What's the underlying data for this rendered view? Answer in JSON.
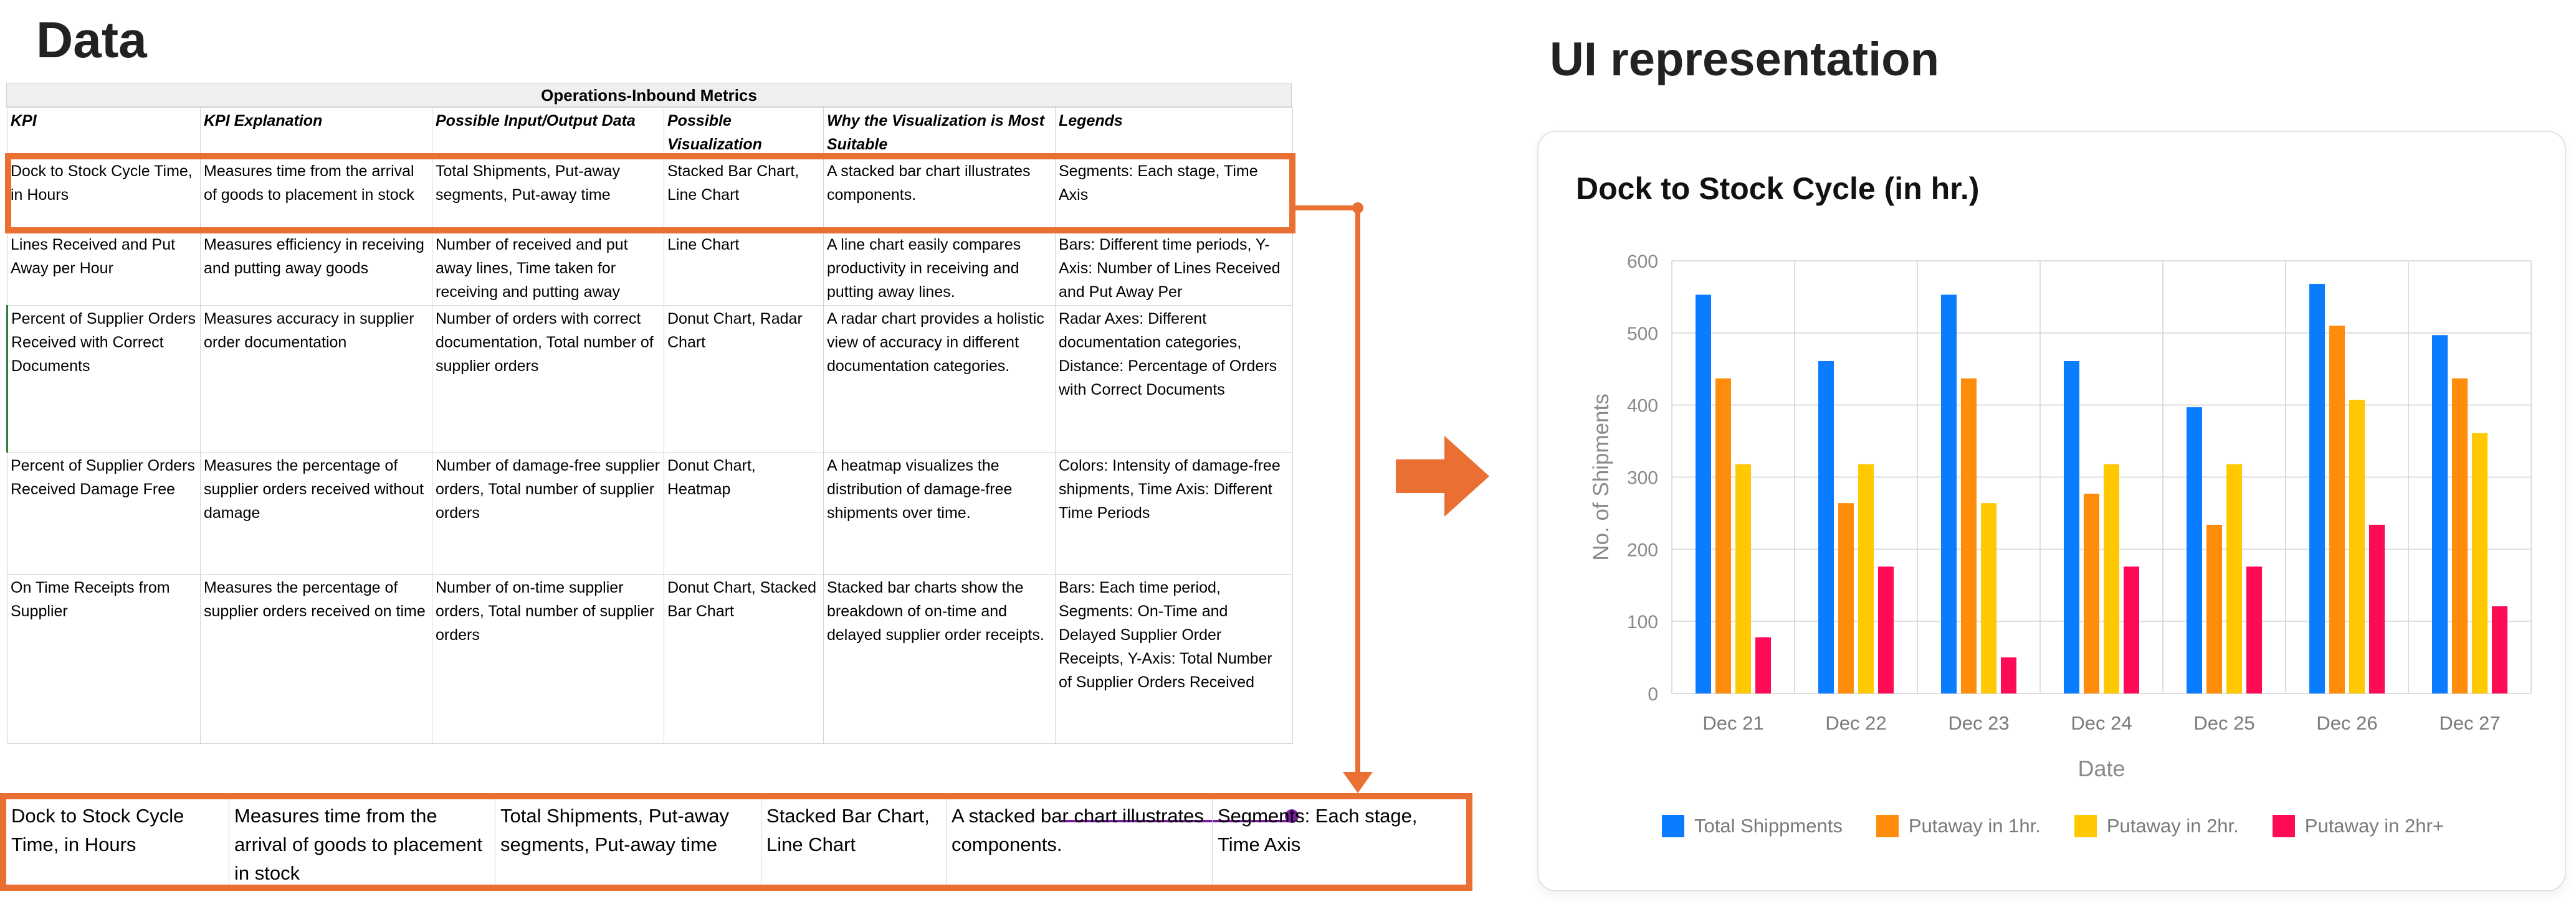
{
  "headings": {
    "data": "Data",
    "ui": "UI representation"
  },
  "sheet": {
    "title": "Operations-Inbound Metrics",
    "headers": [
      "KPI",
      "KPI Explanation",
      "Possible Input/Output Data",
      "Possible Visualization",
      "Why the Visualization is Most Suitable",
      "Legends"
    ],
    "rows": [
      [
        "Dock to Stock Cycle Time, in Hours",
        "Measures time from the arrival of goods to placement in stock",
        "Total Shipments, Put-away segments, Put-away time",
        "Stacked Bar Chart, Line Chart",
        "A stacked bar chart illustrates components.",
        "Segments: Each stage, Time Axis"
      ],
      [
        "Lines Received and Put Away per Hour",
        "Measures efficiency in receiving and putting away goods",
        "Number of received and put away lines, Time taken for receiving and putting away",
        "Line Chart",
        "A line chart easily compares productivity in receiving and putting away lines.",
        "Bars: Different time periods, Y-Axis: Number of Lines Received and Put Away Per"
      ],
      [
        "Percent of Supplier Orders Received with Correct Documents",
        "Measures accuracy in supplier order documentation",
        "Number of orders with correct documentation, Total number of supplier orders",
        "Donut Chart, Radar Chart",
        "A radar chart provides a holistic view of accuracy in different documentation categories.",
        "Radar Axes: Different documentation categories, Distance: Percentage of Orders with Correct Documents"
      ],
      [
        "Percent of Supplier Orders Received Damage Free",
        "Measures the percentage of supplier orders received without damage",
        "Number of damage-free supplier orders, Total number of supplier orders",
        "Donut Chart, Heatmap",
        "A heatmap visualizes the distribution of damage-free shipments over time.",
        "Colors: Intensity of damage-free shipments, Time Axis: Different Time Periods"
      ],
      [
        "On Time Receipts from Supplier",
        "Measures the percentage of supplier orders received on time",
        "Number of on-time supplier orders, Total number of supplier orders",
        "Donut Chart, Stacked Bar Chart",
        "Stacked bar charts show the breakdown of on-time and delayed supplier order receipts.",
        "Bars: Each time period, Segments: On-Time and Delayed Supplier Order Receipts, Y-Axis: Total Number of Supplier Orders Received"
      ]
    ]
  },
  "zoom_row": [
    "Dock to Stock Cycle Time, in Hours",
    "Measures time from the arrival of goods to placement in stock",
    "Total Shipments, Put-away segments, Put-away time",
    "Stacked Bar Chart, Line Chart",
    "A stacked bar chart illustrates components.",
    "Segments: Each stage, Time Axis"
  ],
  "colors": {
    "highlight": "#e96f32",
    "series": [
      "#0a7cff",
      "#ff8c0a",
      "#ffc800",
      "#ff0a55"
    ]
  },
  "card": {
    "title": "Dock to Stock Cycle (in hr.)"
  },
  "chart_data": {
    "type": "bar",
    "title": "Dock to Stock Cycle (in hr.)",
    "xlabel": "Date",
    "ylabel": "No. of Shipments",
    "categories": [
      "Dec 21",
      "Dec 22",
      "Dec 23",
      "Dec 24",
      "Dec 25",
      "Dec 26",
      "Dec 27"
    ],
    "ylim": [
      0,
      600
    ],
    "yticks": [
      0,
      100,
      200,
      300,
      400,
      500,
      600
    ],
    "grid": true,
    "legend": "bottom",
    "series": [
      {
        "name": "Total Shippments",
        "values": [
          553,
          461,
          553,
          461,
          397,
          568,
          497
        ]
      },
      {
        "name": "Putaway in 1hr.",
        "values": [
          437,
          264,
          437,
          277,
          234,
          510,
          437
        ]
      },
      {
        "name": "Putaway in 2hr.",
        "values": [
          318,
          318,
          264,
          318,
          318,
          407,
          361
        ]
      },
      {
        "name": "Putaway in 2hr+",
        "values": [
          78,
          176,
          50,
          176,
          176,
          234,
          121
        ]
      }
    ]
  }
}
